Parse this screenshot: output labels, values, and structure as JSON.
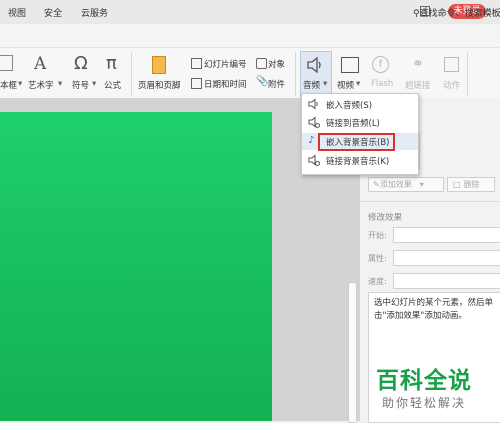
{
  "titlebar": {
    "login_label": "未登录"
  },
  "menubar": {
    "items": [
      "视图",
      "安全",
      "云服务"
    ],
    "search_label": "查找命令、搜索模板"
  },
  "ribbon": {
    "textbox_label": "本框",
    "wordart_label": "艺术字",
    "symbol_label": "符号",
    "formula_label": "公式",
    "header_footer_label": "页眉和页脚",
    "slide_number_label": "幻灯片编号",
    "object_label": "对象",
    "datetime_label": "日期和时间",
    "attachment_label": "附件",
    "audio_label": "音频",
    "video_label": "视频",
    "flash_label": "Flash",
    "hyperlink_label": "超链接",
    "action_label": "动作"
  },
  "audio_menu": {
    "items": [
      "嵌入音频(S)",
      "链接到音频(L)",
      "嵌入背景音乐(B)",
      "链接背景音乐(K)"
    ],
    "highlighted_index": 2
  },
  "panel": {
    "add_effect": "添加效果",
    "delete": "删除",
    "modify_title": "修改效果",
    "start_label": "开始:",
    "property_label": "属性:",
    "speed_label": "速度:",
    "desc_text": "选中幻灯片的某个元素，然后单击\"添加效果\"添加动画。"
  },
  "watermark": {
    "title": "百科全说",
    "subtitle": "助你轻松解决"
  },
  "colors": {
    "slide": "#1fd06a",
    "highlight": "#d9302c",
    "login": "#e2514b"
  }
}
